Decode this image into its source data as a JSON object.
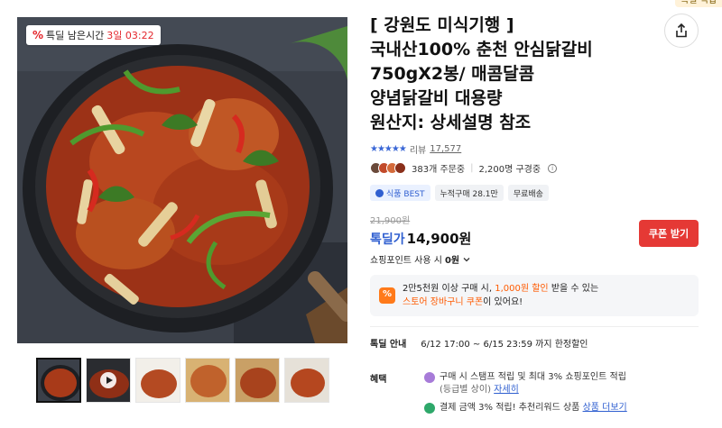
{
  "deal_badge": {
    "prefix": "특딜 남은시간",
    "remaining": "3일 03:22",
    "icon": "percent-icon"
  },
  "title_lines": [
    "[ 강원도 미식기행 ]",
    "국내산100% 춘천 안심닭갈비",
    "750gX2봉/ 매콤달콤",
    "양념닭갈비 대용량",
    "원산지: 상세설명 참조"
  ],
  "corner_tag": "특딜 적립",
  "rating": {
    "stars": "★★★★★",
    "label": "리뷰",
    "count": "17,577"
  },
  "social": {
    "orders": "383개 주문중",
    "subscribers": "2,200명 구경중"
  },
  "chips": [
    {
      "label": "식품 BEST"
    },
    {
      "label": "누적구매 28.1만"
    },
    {
      "label": "무료배송"
    }
  ],
  "price": {
    "original": "21,900원",
    "label": "톡딜가",
    "value": "14,900원"
  },
  "coupon_button": "쿠폰 받기",
  "points_row": {
    "prefix": "쇼핑포인트 사용 시",
    "value": "0원"
  },
  "promo": {
    "line1_prefix": "2만5천원 이상 구매 시, ",
    "line1_highlight": "1,000원 할인",
    "line1_suffix": " 받을 수 있는",
    "line2_highlight": "스토어 장바구니 쿠폰",
    "line2_suffix": "이 있어요!"
  },
  "deal_info": {
    "label": "톡딜 안내",
    "value": "6/12 17:00 ~ 6/15 23:59 까지 한정할인"
  },
  "benefits": {
    "label": "혜택",
    "item1_line1": "구매 시 스탬프 적립 및 최대 3% 쇼핑포인트 적립",
    "item1_line2_muted": "(등급별 상이)",
    "item1_link": "자세히",
    "item2_text": "결제 금액 3% 적립! 추천리워드 상품",
    "item2_link": "상품 더보기"
  },
  "colors": {
    "accent": "#2f5fd0",
    "red": "#e53935",
    "orange": "#ff5a00"
  }
}
